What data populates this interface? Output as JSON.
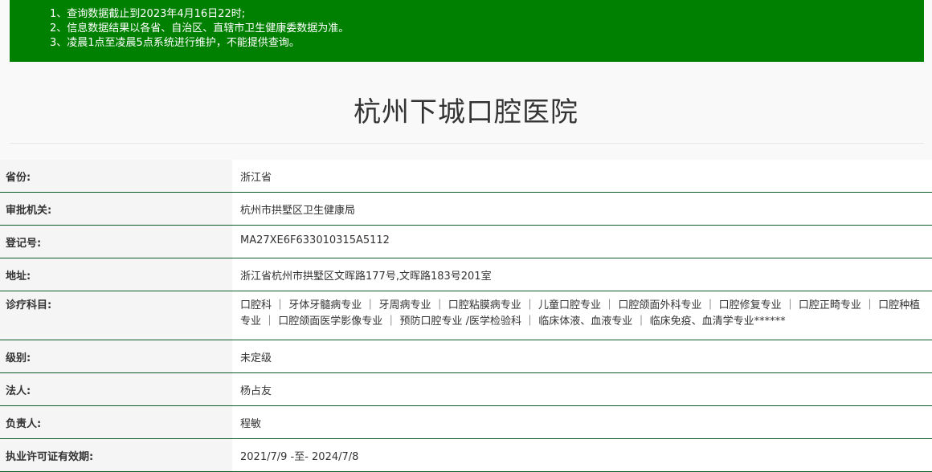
{
  "notice": {
    "lines": [
      "1、查询数据截止到2023年4月16日22时;",
      "2、信息数据结果以各省、自治区、直辖市卫生健康委数据为准。",
      "3、凌晨1点至凌晨5点系统进行维护，不能提供查询。"
    ],
    "color": "#008000"
  },
  "title": "杭州下城口腔医院",
  "rows": [
    {
      "label": "省份:",
      "value": "浙江省"
    },
    {
      "label": "审批机关:",
      "value": "杭州市拱墅区卫生健康局"
    },
    {
      "label": "登记号:",
      "value": "MA27XE6F633010315A5112"
    },
    {
      "label": "地址:",
      "value": "浙江省杭州市拱墅区文晖路177号,文晖路183号201室"
    },
    {
      "label": "诊疗科目:",
      "value": "口腔科 ｜ 牙体牙髓病专业 ｜ 牙周病专业 ｜ 口腔粘膜病专业 ｜ 儿童口腔专业 ｜ 口腔颌面外科专业 ｜ 口腔修复专业 ｜ 口腔正畸专业 ｜ 口腔种植专业 ｜ 口腔颌面医学影像专业 ｜ 预防口腔专业 /医学检验科 ｜ 临床体液、血液专业 ｜ 临床免疫、血清学专业******"
    },
    {
      "label": "级别:",
      "value": "未定级"
    },
    {
      "label": "法人:",
      "value": "杨占友"
    },
    {
      "label": "负责人:",
      "value": "程敏"
    },
    {
      "label": "执业许可证有效期:",
      "value": "2021/7/9 -至- 2024/7/8"
    }
  ]
}
